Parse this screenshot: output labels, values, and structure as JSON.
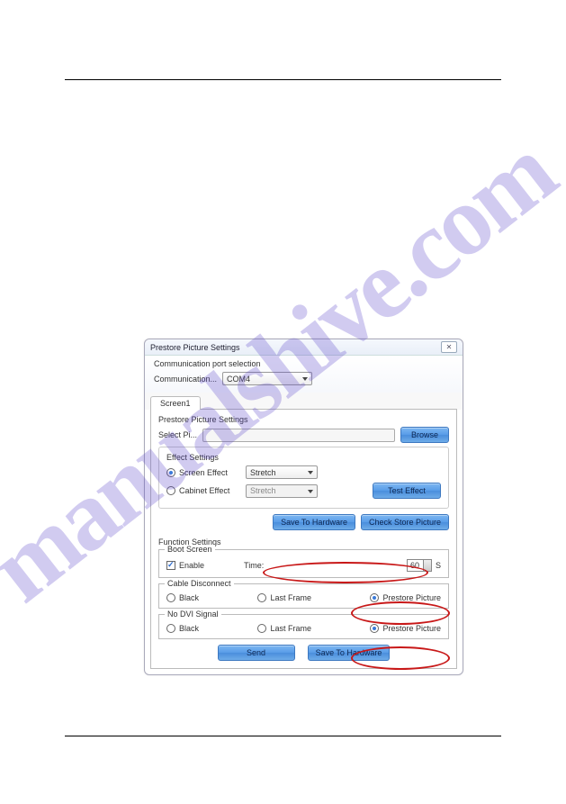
{
  "watermark": "manualshive.com",
  "dialog": {
    "title": "Prestore Picture Settings",
    "close": "✕",
    "comm": {
      "section_title": "Communication port selection",
      "label": "Communication...",
      "value": "COM4"
    },
    "tab": "Screen1",
    "prestore": {
      "title": "Prestore Picture Settings",
      "select_label": "Select Pi...",
      "browse": "Browse"
    },
    "effect": {
      "title": "Effect Settings",
      "screen_label": "Screen Effect",
      "screen_value": "Stretch",
      "cabinet_label": "Cabinet Effect",
      "cabinet_value": "Stretch",
      "test": "Test Effect"
    },
    "buttons": {
      "save_hw": "Save To Hardware",
      "check_store": "Check Store Picture",
      "send": "Send"
    },
    "func": {
      "title": "Function Settings",
      "boot": {
        "legend": "Boot Screen",
        "enable": "Enable",
        "time_label": "Time:",
        "time_value": "60",
        "unit": "S"
      },
      "cable": {
        "legend": "Cable Disconnect",
        "black": "Black",
        "last": "Last Frame",
        "prestore": "Prestore Picture"
      },
      "nodvi": {
        "legend": "No DVI Signal",
        "black": "Black",
        "last": "Last Frame",
        "prestore": "Prestore Picture"
      }
    }
  }
}
